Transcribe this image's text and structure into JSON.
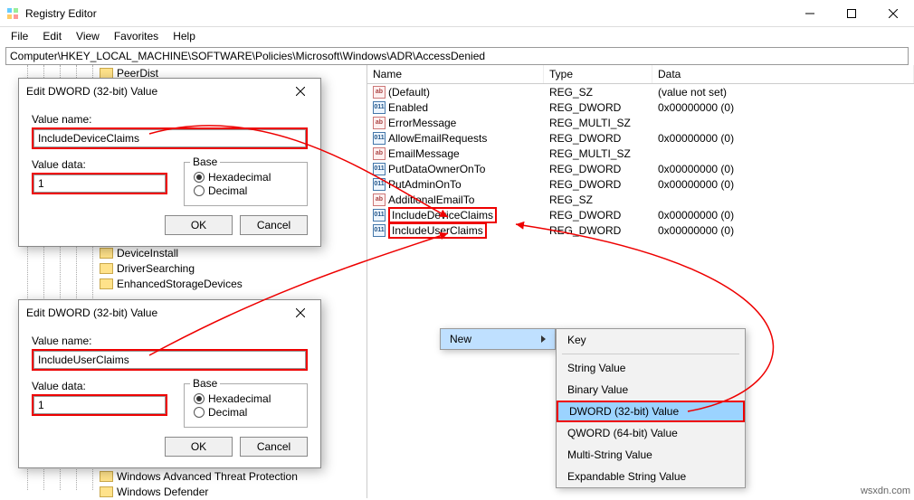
{
  "window": {
    "title": "Registry Editor"
  },
  "menu": {
    "file": "File",
    "edit": "Edit",
    "view": "View",
    "favorites": "Favorites",
    "help": "Help"
  },
  "addressbar": {
    "path": "Computer\\HKEY_LOCAL_MACHINE\\SOFTWARE\\Policies\\Microsoft\\Windows\\ADR\\AccessDenied"
  },
  "columns": {
    "name": "Name",
    "type": "Type",
    "data": "Data"
  },
  "rows": [
    {
      "icon": "ab",
      "name": "(Default)",
      "type": "REG_SZ",
      "data": "(value not set)"
    },
    {
      "icon": "num",
      "name": "Enabled",
      "type": "REG_DWORD",
      "data": "0x00000000 (0)"
    },
    {
      "icon": "ab",
      "name": "ErrorMessage",
      "type": "REG_MULTI_SZ",
      "data": ""
    },
    {
      "icon": "num",
      "name": "AllowEmailRequests",
      "type": "REG_DWORD",
      "data": "0x00000000 (0)"
    },
    {
      "icon": "ab",
      "name": "EmailMessage",
      "type": "REG_MULTI_SZ",
      "data": ""
    },
    {
      "icon": "num",
      "name": "PutDataOwnerOnTo",
      "type": "REG_DWORD",
      "data": "0x00000000 (0)"
    },
    {
      "icon": "num",
      "name": "PutAdminOnTo",
      "type": "REG_DWORD",
      "data": "0x00000000 (0)"
    },
    {
      "icon": "ab",
      "name": "AdditionalEmailTo",
      "type": "REG_SZ",
      "data": ""
    },
    {
      "icon": "num",
      "name": "IncludeDeviceClaims",
      "type": "REG_DWORD",
      "data": "0x00000000 (0)",
      "red": true
    },
    {
      "icon": "num",
      "name": "IncludeUserClaims",
      "type": "REG_DWORD",
      "data": "0x00000000 (0)",
      "red": true
    }
  ],
  "tree": {
    "items": [
      "PeerDist",
      "DeviceInstall",
      "DriverSearching",
      "EnhancedStorageDevices",
      "Windows Advanced Threat Protection",
      "Windows Defender"
    ]
  },
  "dialog1": {
    "title": "Edit DWORD (32-bit) Value",
    "value_name_label": "Value name:",
    "value_name": "IncludeDeviceClaims",
    "value_data_label": "Value data:",
    "value_data": "1",
    "base_label": "Base",
    "hex": "Hexadecimal",
    "dec": "Decimal",
    "ok": "OK",
    "cancel": "Cancel"
  },
  "dialog2": {
    "title": "Edit DWORD (32-bit) Value",
    "value_name_label": "Value name:",
    "value_name": "IncludeUserClaims",
    "value_data_label": "Value data:",
    "value_data": "1",
    "base_label": "Base",
    "hex": "Hexadecimal",
    "dec": "Decimal",
    "ok": "OK",
    "cancel": "Cancel"
  },
  "ctx": {
    "new": "New",
    "sub": [
      "Key",
      "String Value",
      "Binary Value",
      "DWORD (32-bit) Value",
      "QWORD (64-bit) Value",
      "Multi-String Value",
      "Expandable String Value"
    ]
  },
  "watermark": "wsxdn.com"
}
